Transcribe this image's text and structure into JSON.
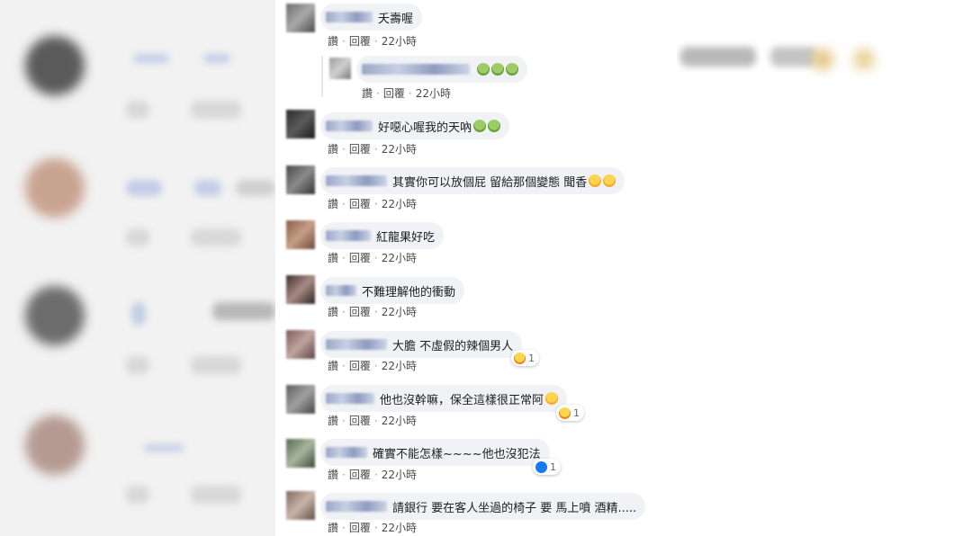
{
  "meta_labels": {
    "like": "讚",
    "sep": "·",
    "reply": "回覆",
    "time": "22小時"
  },
  "comments": [
    {
      "text": "夭壽喔",
      "emoji": []
    },
    {
      "text": "",
      "emoji": [
        "sick",
        "sick",
        "sick"
      ],
      "reply": true
    },
    {
      "text": "好噁心喔我的天吶",
      "emoji": [
        "sick",
        "sick"
      ]
    },
    {
      "text": "其實你可以放個屁 留給那個變態 聞香",
      "emoji": [
        "laugh",
        "laugh"
      ]
    },
    {
      "text": "紅龍果好吃",
      "emoji": []
    },
    {
      "text": "不難理解他的衝動",
      "emoji": []
    },
    {
      "text": "大膽 不虛假的辣個男人",
      "emoji": [],
      "reaction": {
        "type": "haha",
        "count": "1"
      }
    },
    {
      "text": "他也沒幹嘛，保全這樣很正常阿",
      "emoji": [
        "laugh"
      ],
      "reaction": {
        "type": "haha",
        "count": "1"
      }
    },
    {
      "text": "確實不能怎樣~~~~他也沒犯法",
      "emoji": [],
      "reaction": {
        "type": "like",
        "count": "1"
      }
    },
    {
      "text": "請銀行 要在客人坐過的椅子 要 馬上噴 酒精.....",
      "emoji": []
    }
  ]
}
